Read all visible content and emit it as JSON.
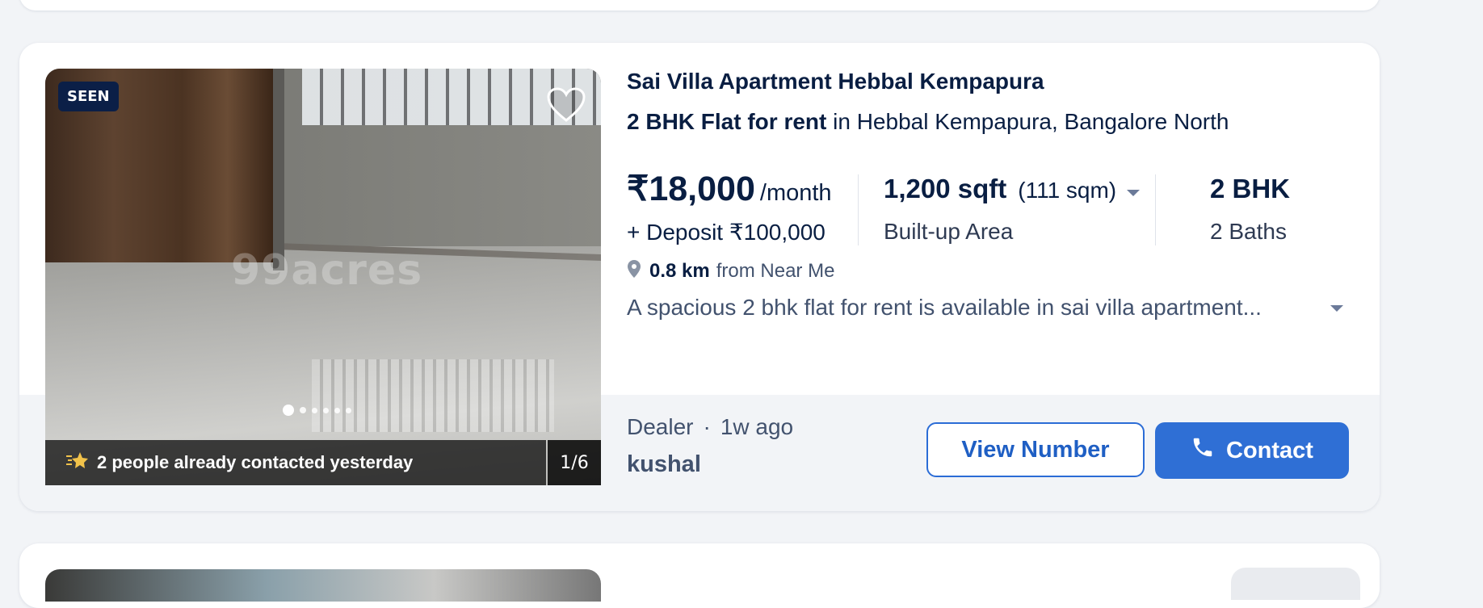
{
  "listing": {
    "seen_badge": "SEEN",
    "watermark": "99acres",
    "photo_counter": "1/6",
    "contacted_text": "2 people already contacted yesterday",
    "title": "Sai Villa Apartment Hebbal Kempapura",
    "subtitle_type": "2 BHK Flat for rent",
    "subtitle_location": " in Hebbal Kempapura, Bangalore North",
    "price": "₹18,000",
    "price_period": "/month",
    "deposit": "+ Deposit ₹100,000",
    "area": "1,200 sqft",
    "area_alt": "(111 sqm)",
    "area_label": "Built-up Area",
    "bhk": "2 BHK",
    "baths": "2 Baths",
    "distance_value": "0.8 km",
    "distance_from": "from Near Me",
    "description": "A spacious 2 bhk flat for rent is available in sai villa apartment...",
    "poster_type": "Dealer",
    "separator": "·",
    "posted_ago": "1w ago",
    "dealer_name": "kushal",
    "view_number_label": "View Number",
    "contact_label": "Contact"
  },
  "carousel": {
    "total_images": 6,
    "active_index": 1
  },
  "icons": {
    "heart": "heart-outline-icon",
    "location": "location-pin-icon",
    "star": "star-icon",
    "phone": "phone-icon",
    "caret": "chevron-down-icon"
  },
  "colors": {
    "accent": "#2f6fd5",
    "title_text": "#091E42",
    "secondary_text": "#42526e",
    "badge_bg": "#0b1f47",
    "page_bg": "#f2f4f7"
  }
}
